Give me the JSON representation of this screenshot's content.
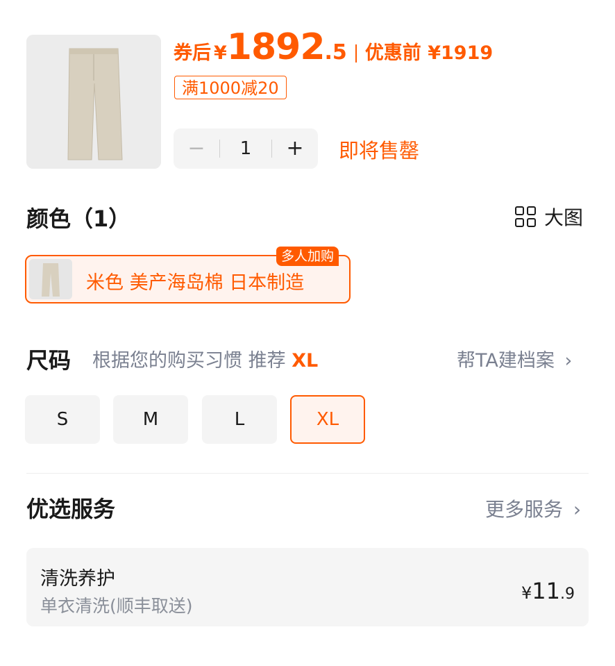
{
  "product": {
    "image_icon": "jeans-image",
    "price_prefix": "券后",
    "currency": "¥",
    "price_int": "1892",
    "price_dec": ".5",
    "orig_price": "优惠前 ¥1919",
    "coupon": "满1000减20",
    "quantity": "1",
    "minus": "−",
    "plus": "+",
    "stock_status": "即将售罄"
  },
  "color": {
    "title": "颜色（1）",
    "big_image_label": "大图",
    "hot_tag": "多人加购",
    "option_label": "米色 美产海岛棉 日本制造"
  },
  "size": {
    "title": "尺码",
    "hint": "根据您的购买习惯 推荐",
    "recommended": "XL",
    "archive_link": "帮TA建档案",
    "options": [
      "S",
      "M",
      "L",
      "XL"
    ],
    "selected": "XL"
  },
  "services": {
    "title": "优选服务",
    "more_link": "更多服务",
    "item": {
      "name": "清洗养护",
      "desc": "单衣清洗(顺丰取送)",
      "currency": "¥",
      "price_int": "11",
      "price_dec": ".9"
    }
  },
  "colors": {
    "accent": "#ff5a00",
    "muted": "#7a8090"
  }
}
